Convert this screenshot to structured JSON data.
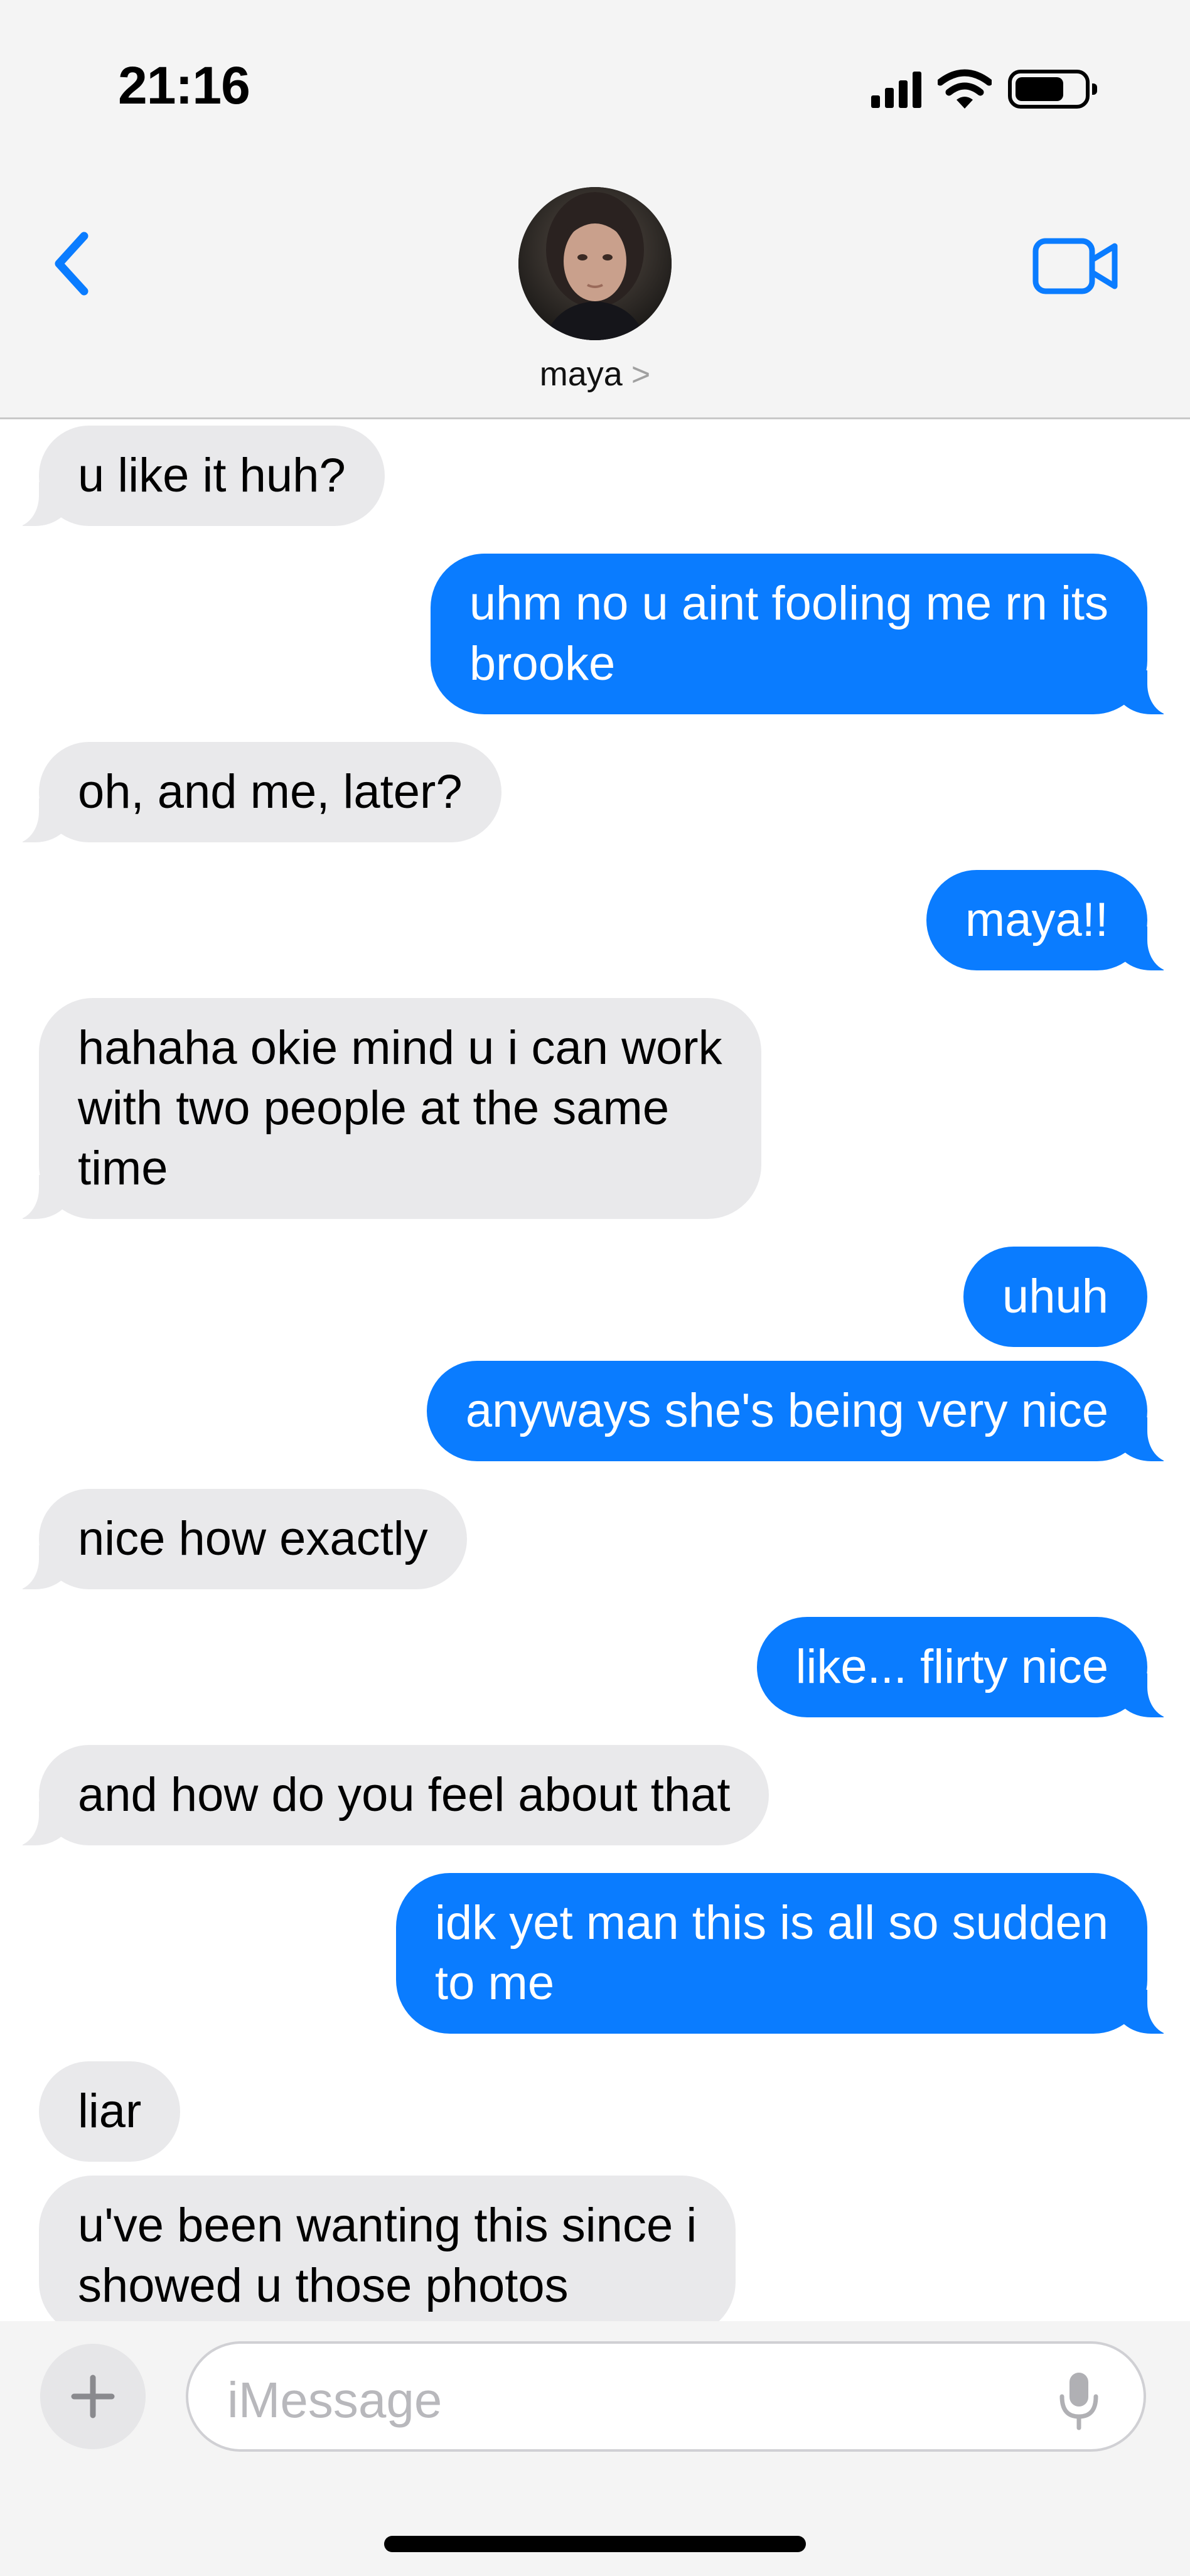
{
  "status_bar": {
    "time": "21:16"
  },
  "header": {
    "contact_name": "maya",
    "chevron": ">"
  },
  "messages": [
    {
      "dir": "in",
      "text": "u like it huh?"
    },
    {
      "dir": "out",
      "text": "uhm no u aint fooling me rn its\nbrooke"
    },
    {
      "dir": "in",
      "text": "oh, and me, later?"
    },
    {
      "dir": "out",
      "text": "maya!!"
    },
    {
      "dir": "in",
      "text": "hahaha okie mind u i can work\nwith two people at the same\ntime"
    },
    {
      "dir": "out",
      "text": "uhuh"
    },
    {
      "dir": "out",
      "text": "anyways she's being very nice"
    },
    {
      "dir": "in",
      "text": "nice how exactly"
    },
    {
      "dir": "out",
      "text": "like... flirty nice"
    },
    {
      "dir": "in",
      "text": "and how do you feel about that"
    },
    {
      "dir": "out",
      "text": "idk yet man this is all so sudden\nto me"
    },
    {
      "dir": "in",
      "text": "liar"
    },
    {
      "dir": "in",
      "text": "u've been wanting this since i\nshowed u those photos"
    }
  ],
  "composer": {
    "placeholder": "iMessage",
    "plus_label": "+"
  },
  "icons": {
    "back": "chevron-left-icon",
    "video": "video-camera-icon",
    "mic": "microphone-icon",
    "signal": "cellular-signal-icon",
    "wifi": "wifi-icon",
    "battery": "battery-icon"
  },
  "colors": {
    "outgoing_bubble": "#0a7cff",
    "incoming_bubble": "#e9e9eb",
    "accent": "#0a7cff"
  }
}
